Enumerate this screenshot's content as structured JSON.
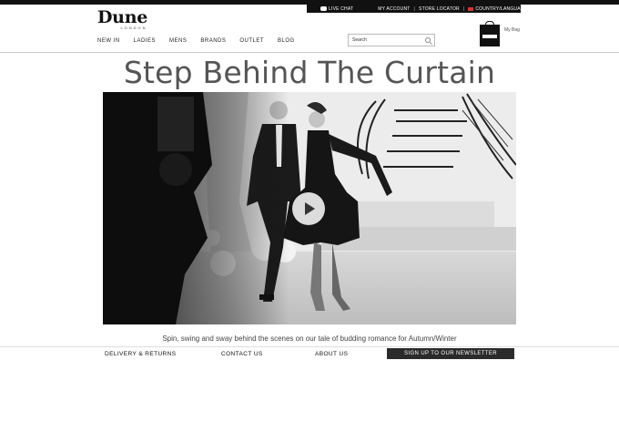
{
  "utility_bar": {
    "live_chat": "LIVE CHAT",
    "my_account": "MY ACCOUNT",
    "store_locator": "STORE LOCATOR",
    "country_language": "COUNTRY/LANGUAGE"
  },
  "logo": {
    "name": "Dune",
    "subtitle": "LONDON"
  },
  "nav": {
    "items": [
      "NEW IN",
      "LADIES",
      "MENS",
      "BRANDS",
      "OUTLET",
      "BLOG"
    ]
  },
  "search": {
    "placeholder": "Search"
  },
  "bag": {
    "label": "My Bag",
    "tag": "Dune"
  },
  "hero": {
    "title": "Step Behind The Curtain",
    "caption": "Spin, swing and sway behind the scenes on our tale of budding romance for Autumn/Winter"
  },
  "footer": {
    "delivery": "DELIVERY & RETURNS",
    "contact": "CONTACT US",
    "about": "ABOUT US",
    "newsletter": "SIGN UP TO OUR NEWSLETTER"
  },
  "colors": {
    "topbar": "#111111",
    "title": "#555555",
    "newsletter_bg": "#2b2b2b"
  }
}
